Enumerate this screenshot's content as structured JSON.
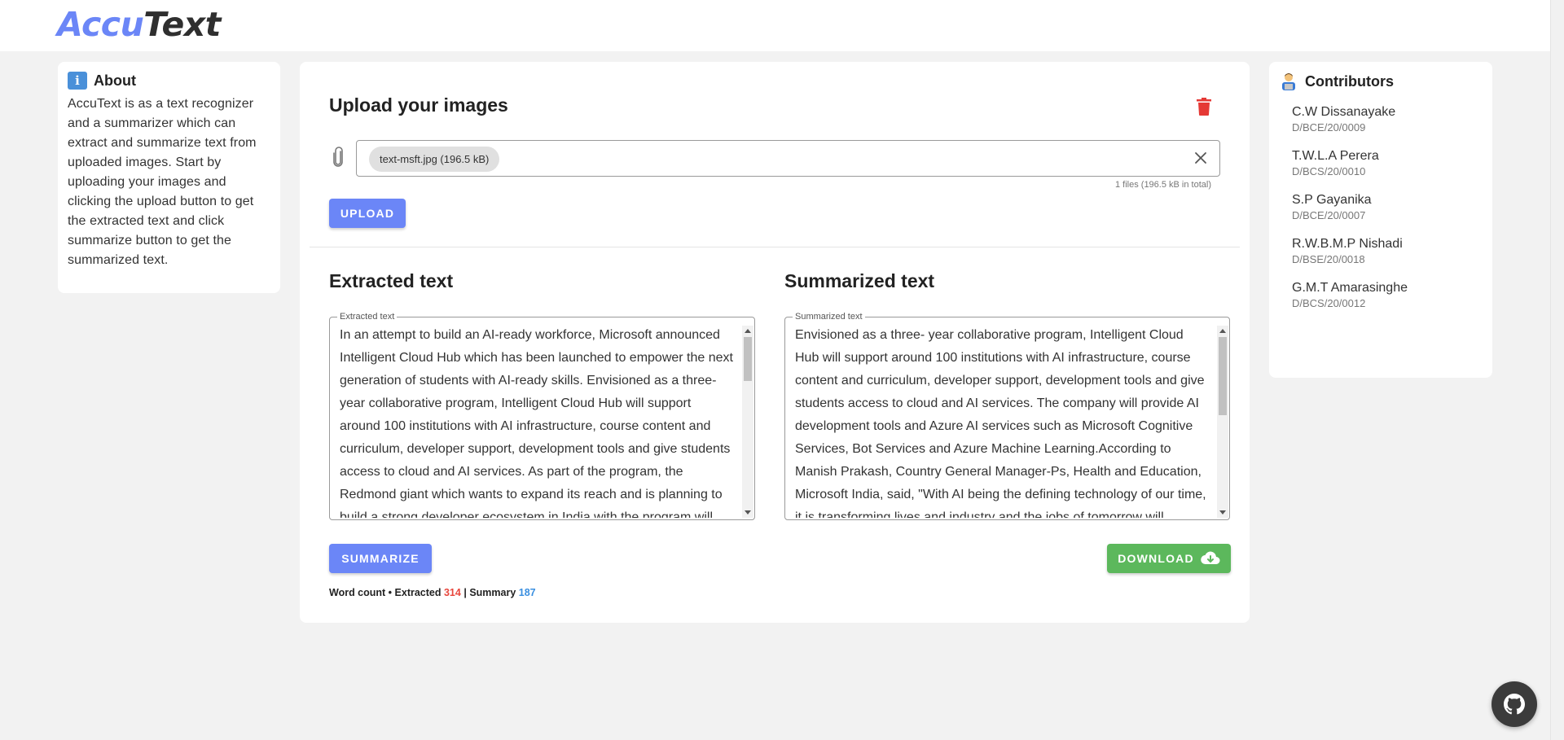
{
  "header": {
    "logo_part1": "Accu",
    "logo_part2": "Text"
  },
  "about": {
    "title": "About",
    "body": "AccuText is as a text recognizer and a summarizer which can extract and summarize text from uploaded images. Start by uploading your images and clicking the upload button to get the extracted text and click summarize button to get the summarized text."
  },
  "upload": {
    "title": "Upload your images",
    "file_chip": "text-msft.jpg (196.5 kB)",
    "file_count": "1 files (196.5 kB in total)",
    "upload_label": "UPLOAD"
  },
  "extracted": {
    "title": "Extracted text",
    "legend": "Extracted text",
    "text": "In an attempt to build an AI-ready workforce, Microsoft announced Intelligent Cloud Hub which has been launched to empower the next generation of students with AI-ready skills. Envisioned as a three-year collaborative program, Intelligent Cloud Hub will support around 100 institutions with AI infrastructure, course content and curriculum, developer support, development tools and give students access to cloud and AI services. As part of the program, the Redmond giant which wants to expand its reach and is planning to build a strong developer ecosystem in India with the program will"
  },
  "summarized": {
    "title": "Summarized text",
    "legend": "Summarized text",
    "text": "Envisioned as a three- year collaborative program, Intelligent Cloud Hub will support around 100 institutions with AI infrastructure, course content and curriculum, developer support, development tools and give students access to cloud and AI services. The company will provide AI development tools and Azure AI services such as Microsoft Cognitive Services, Bot Services and Azure Machine Learning.According to Manish Prakash, Country General Manager-Ps, Health and Education, Microsoft India, said, \"With AI being the defining technology of our time, it is transforming lives and industry and the jobs of tomorrow will"
  },
  "actions": {
    "summarize_label": "SUMMARIZE",
    "download_label": "DOWNLOAD"
  },
  "wordcount": {
    "prefix": "Word count • Extracted",
    "extracted": "314",
    "separator": "|",
    "summary_label": "Summary",
    "summary": "187"
  },
  "contributors": {
    "title": "Contributors",
    "items": [
      {
        "name": "C.W Dissanayake",
        "id": "D/BCE/20/0009"
      },
      {
        "name": "T.W.L.A Perera",
        "id": "D/BCS/20/0010"
      },
      {
        "name": "S.P Gayanika",
        "id": "D/BCE/20/0007"
      },
      {
        "name": "R.W.B.M.P Nishadi",
        "id": "D/BSE/20/0018"
      },
      {
        "name": "G.M.T Amarasinghe",
        "id": "D/BCS/20/0012"
      }
    ]
  },
  "colors": {
    "accent": "#6b86f7",
    "download": "#5cb85c",
    "danger": "#e53935",
    "extracted_count": "#e8473d",
    "summary_count": "#3a8fe0"
  },
  "icons": [
    "info-icon",
    "trash-icon",
    "paperclip-icon",
    "close-icon",
    "cloud-download-icon",
    "person-icon",
    "github-icon"
  ]
}
